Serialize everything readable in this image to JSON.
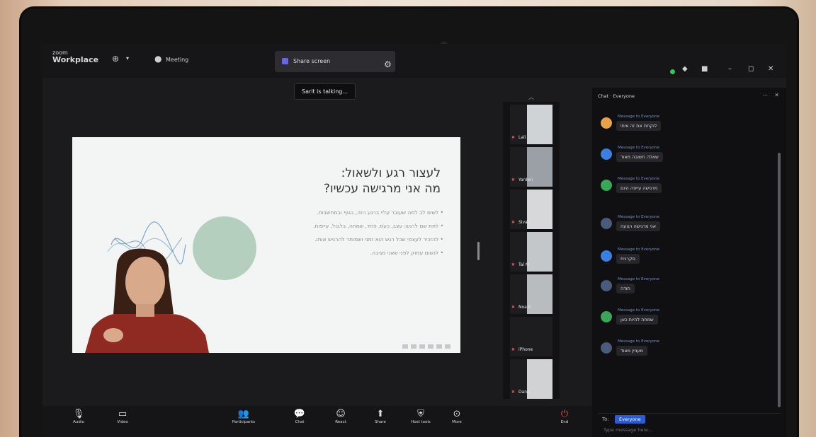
{
  "app": {
    "brand_small": "zoom",
    "brand_title": "Workplace",
    "top_chip": "Meeting"
  },
  "share_tab": {
    "label": "Share screen"
  },
  "tooltip": {
    "text": "Sarit is talking..."
  },
  "slide": {
    "title_line1": "לעצור רגע ולשאול:",
    "title_line2": "מה אני מרגישה עכשיו?",
    "bullets": [
      "• לשים לב למה שעובר עליי ברגע הזה, בגוף ובמחשבות.",
      "• לתת שם לרגש: עצב, כעס, פחד, שמחה, בלבול, עייפות.",
      "• להזכיר לעצמי שכל רגש הוא זמני ושמותר להרגיש אותו.",
      "• לנשום עמוק לפני שאני מגיבה."
    ]
  },
  "participants": [
    {
      "name": "Lali"
    },
    {
      "name": "Yarden"
    },
    {
      "name": "Sivan"
    },
    {
      "name": "Tal M"
    },
    {
      "name": "Noa K"
    },
    {
      "name": "iPhone"
    },
    {
      "name": "Dana"
    }
  ],
  "chat": {
    "header": "Chat · Everyone",
    "messages": [
      {
        "meta": "Message to Everyone",
        "text": "לוקחת את זה איתי",
        "color": "#e8a24a"
      },
      {
        "meta": "Message to Everyone",
        "text": "שאלה חשובה מאוד",
        "color": "#3b7fe0"
      },
      {
        "meta": "Message to Everyone",
        "text": "מרגישה עייפה היום",
        "color": "#3aa657"
      },
      {
        "meta": "Message to Everyone",
        "text": "אני מרגישה רגועה",
        "color": "#4a5a7a"
      },
      {
        "meta": "Message to Everyone",
        "text": "סקרנית",
        "color": "#3b7fe0"
      },
      {
        "meta": "Message to Everyone",
        "text": "תודה",
        "color": "#4a5a7a"
      },
      {
        "meta": "Message to Everyone",
        "text": "שמחה להיות כאן",
        "color": "#3aa657"
      },
      {
        "meta": "Message to Everyone",
        "text": "מעניין מאוד",
        "color": "#4a5a7a"
      }
    ],
    "footer_to": "Everyone",
    "footer_hint": "Type message here..."
  },
  "toolbar": {
    "audio": "Audio",
    "video": "Video",
    "participants": "Participants",
    "chat": "Chat",
    "react": "React",
    "share": "Share",
    "host_tools": "Host tools",
    "more": "More",
    "end": "End"
  }
}
